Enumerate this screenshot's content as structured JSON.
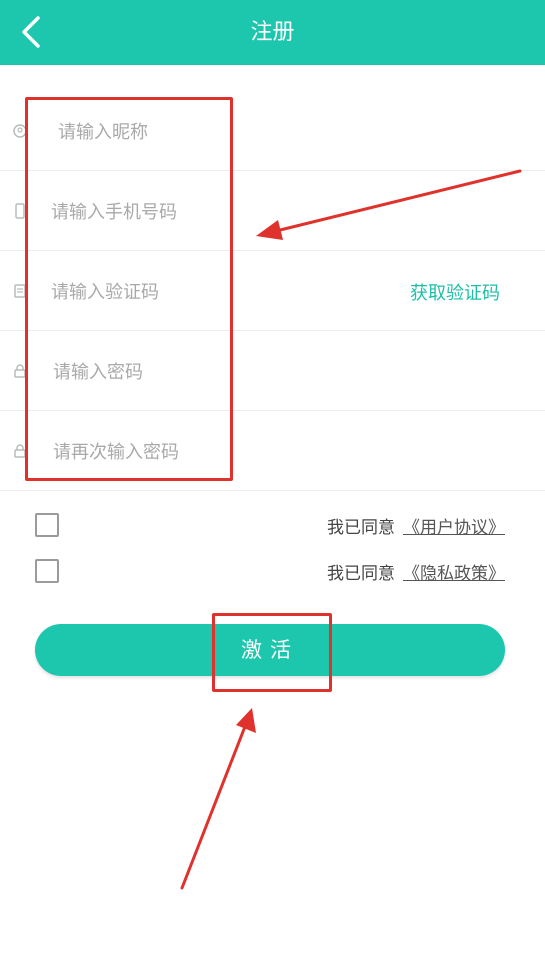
{
  "header": {
    "title": "注册",
    "back_icon": "chevron-left-icon"
  },
  "form": {
    "nickname": {
      "placeholder": "请输入昵称",
      "icon": "user-icon"
    },
    "phone": {
      "placeholder": "请输入手机号码",
      "icon": "phone-icon"
    },
    "code": {
      "placeholder": "请输入验证码",
      "icon": "sms-icon",
      "get_code_label": "获取验证码"
    },
    "password": {
      "placeholder": "请输入密码",
      "icon": "lock-icon"
    },
    "password_confirm": {
      "placeholder": "请再次输入密码",
      "icon": "lock-icon"
    }
  },
  "agreements": [
    {
      "prefix": "我已同意",
      "link": "《用户协议》",
      "checked": false
    },
    {
      "prefix": "我已同意",
      "link": "《隐私政策》",
      "checked": false
    }
  ],
  "activate_button": {
    "label": "激活"
  },
  "colors": {
    "accent": "#1dc7ae",
    "link_green": "#1dbfa8",
    "annotation_red": "#e0322c"
  }
}
